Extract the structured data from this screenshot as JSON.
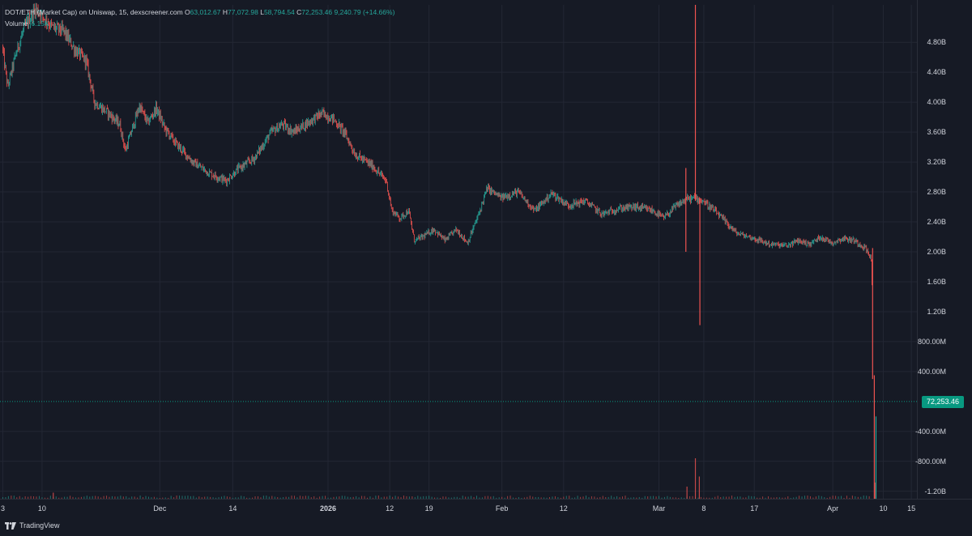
{
  "legend": {
    "symbol": "DOT/ETH (Market Cap) on Uniswap, 15, dexscreener.com",
    "o_label": "O",
    "o": "63,012.67",
    "h_label": "H",
    "h": "77,072.98",
    "l_label": "L",
    "l": "58,794.54",
    "c_label": "C",
    "c": "72,253.46",
    "change": "9,240.79 (+14.66%)",
    "volume_label": "Volume",
    "volume": "6.15K"
  },
  "last_price": "72,253.46",
  "branding": "TradingView",
  "colors": {
    "up": "#26a69a",
    "down": "#ef5350",
    "background": "#161a25",
    "grid": "#232734",
    "text": "#d1d4dc",
    "price_tag": "#089981"
  },
  "chart_data": {
    "type": "candlestick",
    "y_ticks": [
      {
        "label": "4.80B",
        "value": 4800000000
      },
      {
        "label": "4.40B",
        "value": 4400000000
      },
      {
        "label": "4.00B",
        "value": 4000000000
      },
      {
        "label": "3.60B",
        "value": 3600000000
      },
      {
        "label": "3.20B",
        "value": 3200000000
      },
      {
        "label": "2.80B",
        "value": 2800000000
      },
      {
        "label": "2.40B",
        "value": 2400000000
      },
      {
        "label": "2.00B",
        "value": 2000000000
      },
      {
        "label": "1.60B",
        "value": 1600000000
      },
      {
        "label": "1.20B",
        "value": 1200000000
      },
      {
        "label": "800.00M",
        "value": 800000000
      },
      {
        "label": "400.00M",
        "value": 400000000
      },
      {
        "label": "-400.00M",
        "value": -400000000
      },
      {
        "label": "-800.00M",
        "value": -800000000
      },
      {
        "label": "-1.20B",
        "value": -1200000000
      }
    ],
    "x_ticks": [
      {
        "label": "3",
        "day": 0,
        "bold": false
      },
      {
        "label": "10",
        "day": 7,
        "bold": false
      },
      {
        "label": "Dec",
        "day": 28,
        "bold": false
      },
      {
        "label": "14",
        "day": 41,
        "bold": false
      },
      {
        "label": "2026",
        "day": 58,
        "bold": true
      },
      {
        "label": "12",
        "day": 69,
        "bold": false
      },
      {
        "label": "19",
        "day": 76,
        "bold": false
      },
      {
        "label": "Feb",
        "day": 89,
        "bold": false
      },
      {
        "label": "12",
        "day": 100,
        "bold": false
      },
      {
        "label": "Mar",
        "day": 117,
        "bold": false
      },
      {
        "label": "8",
        "day": 125,
        "bold": false
      },
      {
        "label": "17",
        "day": 134,
        "bold": false
      },
      {
        "label": "Apr",
        "day": 148,
        "bold": false
      },
      {
        "label": "10",
        "day": 157,
        "bold": false
      },
      {
        "label": "15",
        "day": 162,
        "bold": false
      }
    ],
    "x_range_days": [
      -0.5,
      163
    ],
    "y_range": [
      -1300000000,
      5300000000
    ],
    "trend": [
      {
        "day": 0,
        "value": 4750000000.0
      },
      {
        "day": 1,
        "value": 4200000000.0
      },
      {
        "day": 2.5,
        "value": 4650000000.0
      },
      {
        "day": 4,
        "value": 5000000000.0
      },
      {
        "day": 6,
        "value": 5250000000.0
      },
      {
        "day": 9,
        "value": 5000000000.0
      },
      {
        "day": 11,
        "value": 4950000000.0
      },
      {
        "day": 13,
        "value": 4700000000.0
      },
      {
        "day": 15,
        "value": 4550000000.0
      },
      {
        "day": 16.5,
        "value": 4000000000.0
      },
      {
        "day": 19,
        "value": 3850000000.0
      },
      {
        "day": 21,
        "value": 3700000000.0
      },
      {
        "day": 22,
        "value": 3350000000.0
      },
      {
        "day": 24.5,
        "value": 3950000000.0
      },
      {
        "day": 26,
        "value": 3720000000.0
      },
      {
        "day": 27.5,
        "value": 3920000000.0
      },
      {
        "day": 29,
        "value": 3650000000.0
      },
      {
        "day": 31,
        "value": 3450000000.0
      },
      {
        "day": 34,
        "value": 3200000000.0
      },
      {
        "day": 37,
        "value": 3050000000.0
      },
      {
        "day": 40,
        "value": 2950000000.0
      },
      {
        "day": 42,
        "value": 3100000000.0
      },
      {
        "day": 45,
        "value": 3250000000.0
      },
      {
        "day": 48,
        "value": 3600000000.0
      },
      {
        "day": 50,
        "value": 3700000000.0
      },
      {
        "day": 52,
        "value": 3600000000.0
      },
      {
        "day": 55,
        "value": 3750000000.0
      },
      {
        "day": 57,
        "value": 3850000000.0
      },
      {
        "day": 59,
        "value": 3780000000.0
      },
      {
        "day": 61,
        "value": 3600000000.0
      },
      {
        "day": 63,
        "value": 3300000000.0
      },
      {
        "day": 66,
        "value": 3150000000.0
      },
      {
        "day": 68.5,
        "value": 2950000000.0
      },
      {
        "day": 69.5,
        "value": 2550000000.0
      },
      {
        "day": 71,
        "value": 2450000000.0
      },
      {
        "day": 72.5,
        "value": 2550000000.0
      },
      {
        "day": 73.5,
        "value": 2150000000.0
      },
      {
        "day": 75,
        "value": 2200000000.0
      },
      {
        "day": 77,
        "value": 2300000000.0
      },
      {
        "day": 79,
        "value": 2150000000.0
      },
      {
        "day": 81,
        "value": 2300000000.0
      },
      {
        "day": 83,
        "value": 2120000000.0
      },
      {
        "day": 85,
        "value": 2500000000.0
      },
      {
        "day": 86.5,
        "value": 2850000000.0
      },
      {
        "day": 89,
        "value": 2720000000.0
      },
      {
        "day": 92,
        "value": 2800000000.0
      },
      {
        "day": 95,
        "value": 2550000000.0
      },
      {
        "day": 98,
        "value": 2780000000.0
      },
      {
        "day": 101,
        "value": 2620000000.0
      },
      {
        "day": 104,
        "value": 2680000000.0
      },
      {
        "day": 107,
        "value": 2500000000.0
      },
      {
        "day": 110,
        "value": 2580000000.0
      },
      {
        "day": 113,
        "value": 2600000000.0
      },
      {
        "day": 116,
        "value": 2550000000.0
      },
      {
        "day": 118,
        "value": 2450000000.0
      },
      {
        "day": 120,
        "value": 2600000000.0
      },
      {
        "day": 122,
        "value": 2700000000.0
      },
      {
        "day": 123.5,
        "value": 2720000000.0
      },
      {
        "day": 125,
        "value": 2680000000.0
      },
      {
        "day": 127,
        "value": 2550000000.0
      },
      {
        "day": 129,
        "value": 2400000000.0
      },
      {
        "day": 131,
        "value": 2250000000.0
      },
      {
        "day": 134,
        "value": 2180000000.0
      },
      {
        "day": 137,
        "value": 2100000000.0
      },
      {
        "day": 140,
        "value": 2080000000.0
      },
      {
        "day": 142,
        "value": 2150000000.0
      },
      {
        "day": 144,
        "value": 2100000000.0
      },
      {
        "day": 146,
        "value": 2200000000.0
      },
      {
        "day": 148,
        "value": 2120000000.0
      },
      {
        "day": 150,
        "value": 2180000000.0
      },
      {
        "day": 152,
        "value": 2150000000.0
      },
      {
        "day": 154,
        "value": 2050000000.0
      },
      {
        "day": 155,
        "value": 1900000000.0
      },
      {
        "day": 155.6,
        "value": 300000000.0
      },
      {
        "day": 156,
        "value": 72253.46
      }
    ],
    "wick_events": [
      {
        "day": 121.8,
        "high": 3120000000.0,
        "low": 2000000000.0,
        "color": "down"
      },
      {
        "day": 123.5,
        "high": 5300000000.0,
        "low": 2680000000.0,
        "color": "down"
      },
      {
        "day": 124.3,
        "high": 2720000000.0,
        "low": 1020000000.0,
        "color": "down"
      },
      {
        "day": 155.1,
        "high": 2050000000.0,
        "low": 300000000.0,
        "color": "down"
      },
      {
        "day": 155.4,
        "high": 350000000.0,
        "low": -1300000000.0,
        "color": "down"
      },
      {
        "day": 155.7,
        "high": -200000000.0,
        "low": -1300000000.0,
        "color": "up"
      }
    ],
    "volume_spikes": [
      {
        "day": 9,
        "height": 0.15
      },
      {
        "day": 122,
        "height": 0.3
      },
      {
        "day": 123.5,
        "height": 1.0
      },
      {
        "day": 124.2,
        "height": 0.55
      },
      {
        "day": 155.5,
        "height": 0.4
      }
    ],
    "last_value": 72253.46
  }
}
